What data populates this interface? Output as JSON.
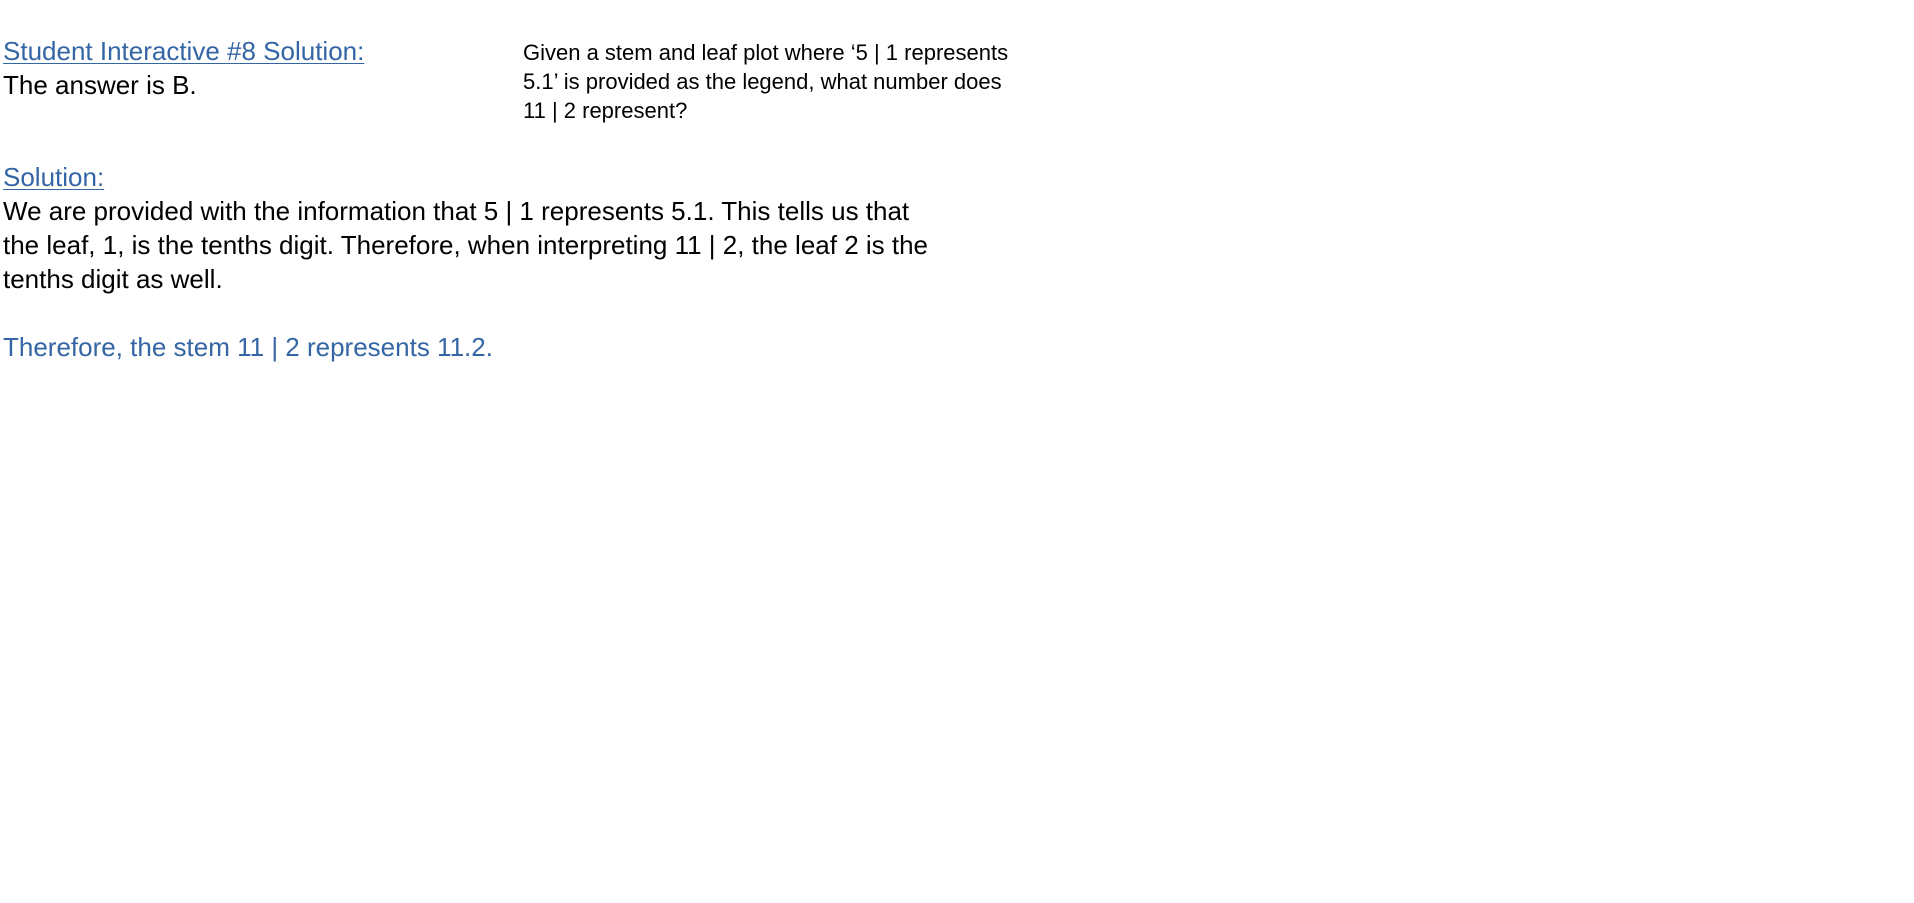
{
  "header": {
    "title": "Student Interactive #8 Solution:",
    "answer": "The answer is B."
  },
  "question": {
    "lines": [
      "Given a stem and leaf plot where ‘5 | 1 represents",
      "5.1’ is provided as the legend, what number does",
      "11 | 2 represent?"
    ]
  },
  "solution": {
    "heading": "Solution:",
    "lines": [
      "We are provided with the information that 5 | 1 represents 5.1.  This tells us that",
      "the leaf, 1, is the tenths digit.  Therefore, when interpreting 11 | 2, the leaf 2 is the",
      "tenths digit as well."
    ],
    "conclusion": "Therefore, the stem 11 | 2 represents 11.2."
  },
  "colors": {
    "accent": "#3465a4",
    "text": "#000000",
    "background": "#ffffff"
  }
}
